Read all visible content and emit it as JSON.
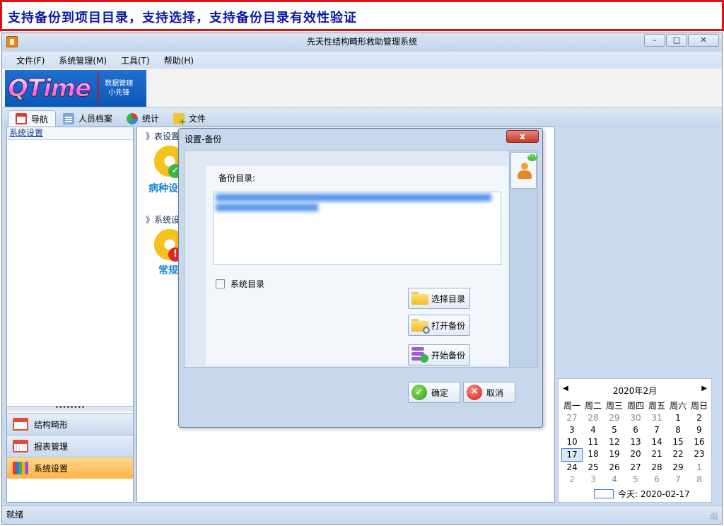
{
  "banner": {
    "text": "支持备份到项目目录，支持选择，支持备份目录有效性验证"
  },
  "window": {
    "title": "先天性结构畸形救助管理系统",
    "controls": {
      "minimize": "▭",
      "maximize": "□",
      "close": "✕"
    }
  },
  "menu": {
    "items": [
      "文件(F)",
      "系统管理(M)",
      "工具(T)",
      "帮助(H)"
    ]
  },
  "logo": {
    "word": "QTime",
    "sub_line1": "数据管理",
    "sub_line2": "小先锋"
  },
  "tabs": [
    {
      "label": "导航",
      "icon": "nav-icon",
      "active": true
    },
    {
      "label": "人员档案",
      "icon": "person-list-icon",
      "active": false
    },
    {
      "label": "统计",
      "icon": "pie-chart-icon",
      "active": false
    },
    {
      "label": "文件",
      "icon": "folder-add-icon",
      "active": false
    }
  ],
  "left_panel": {
    "header": "系统设置",
    "splitter": "••••••••",
    "nav_buttons": [
      {
        "label": "结构畸形",
        "icon": "calendar-icon",
        "active": false
      },
      {
        "label": "报表管理",
        "icon": "report-icon",
        "active": false
      },
      {
        "label": "系统设置",
        "icon": "system-icon",
        "active": true
      }
    ]
  },
  "main": {
    "section1_head": "》表设置",
    "section1_item": "病种设",
    "section2_head": "》系统设",
    "section2_item": "常规"
  },
  "calendar": {
    "month_label": "2020年2月",
    "prev": "◀",
    "next": "▶",
    "weekdays": [
      "周一",
      "周二",
      "周三",
      "周四",
      "周五",
      "周六",
      "周日"
    ],
    "days": [
      [
        "27",
        "28",
        "29",
        "30",
        "31",
        "1",
        "2"
      ],
      [
        "3",
        "4",
        "5",
        "6",
        "7",
        "8",
        "9"
      ],
      [
        "10",
        "11",
        "12",
        "13",
        "14",
        "15",
        "16"
      ],
      [
        "17",
        "18",
        "19",
        "20",
        "21",
        "22",
        "23"
      ],
      [
        "24",
        "25",
        "26",
        "27",
        "28",
        "29",
        "1"
      ],
      [
        "2",
        "3",
        "4",
        "5",
        "6",
        "7",
        "8"
      ]
    ],
    "selected": "17",
    "today_text": "今天: 2020-02-17"
  },
  "status": {
    "text": "就绪"
  },
  "dialog": {
    "title": "设置-备份",
    "close_label": "x",
    "backup_dir_label": "备份目录:",
    "backup_dir_value_prefix": "D:",
    "system_dir_label": "系统目录",
    "buttons": {
      "select_dir": "选择目录",
      "open_backup": "打开备份",
      "start_backup": "开始备份",
      "ok": "确定",
      "cancel": "取消"
    }
  },
  "colors": {
    "banner_border": "#e01010",
    "banner_text": "#0a1aa8",
    "active_nav": "#ffb347",
    "accent_link": "#1a86d8"
  }
}
